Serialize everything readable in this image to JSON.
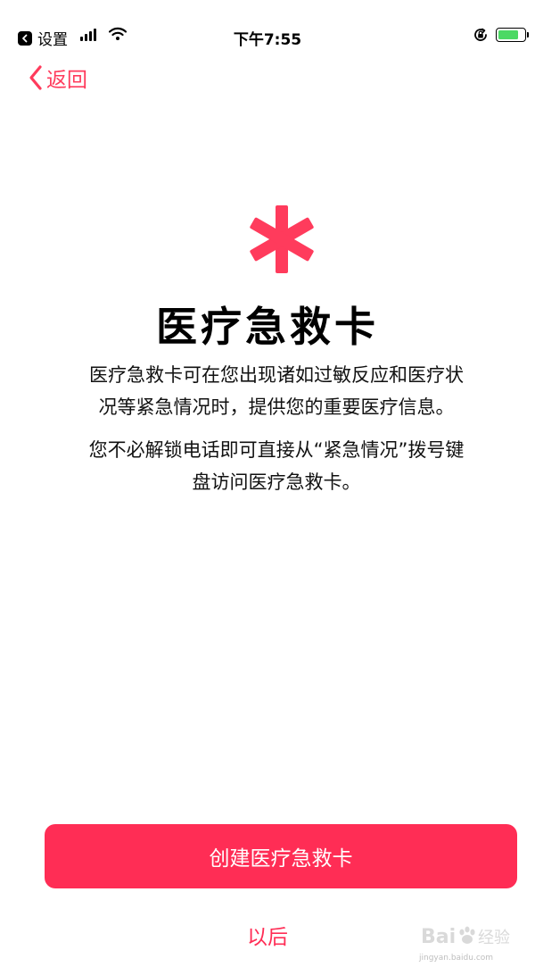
{
  "status_bar": {
    "back_app_label": "设置",
    "time": "下午7:55",
    "battery_level": 0.8,
    "battery_color": "#4cd964"
  },
  "nav": {
    "back_label": "返回",
    "accent_color": "#ff3b5c"
  },
  "hero": {
    "icon": "asterisk-icon",
    "title": "医疗急救卡",
    "description_line1": "医疗急救卡可在您出现诸如过敏反应和医疗状",
    "description_line2": "况等紧急情况时，提供您的重要医疗信息。",
    "unlock_line1": "您不必解锁电话即可直接从“紧急情况”拨号键",
    "unlock_line2": "盘访问医疗急救卡。"
  },
  "actions": {
    "create_label": "创建医疗急救卡",
    "later_label": "以后",
    "primary_color": "#ff2d55"
  },
  "watermark": {
    "logo": "baidu-jingyan-logo",
    "url": "jingyan.baidu.com"
  }
}
